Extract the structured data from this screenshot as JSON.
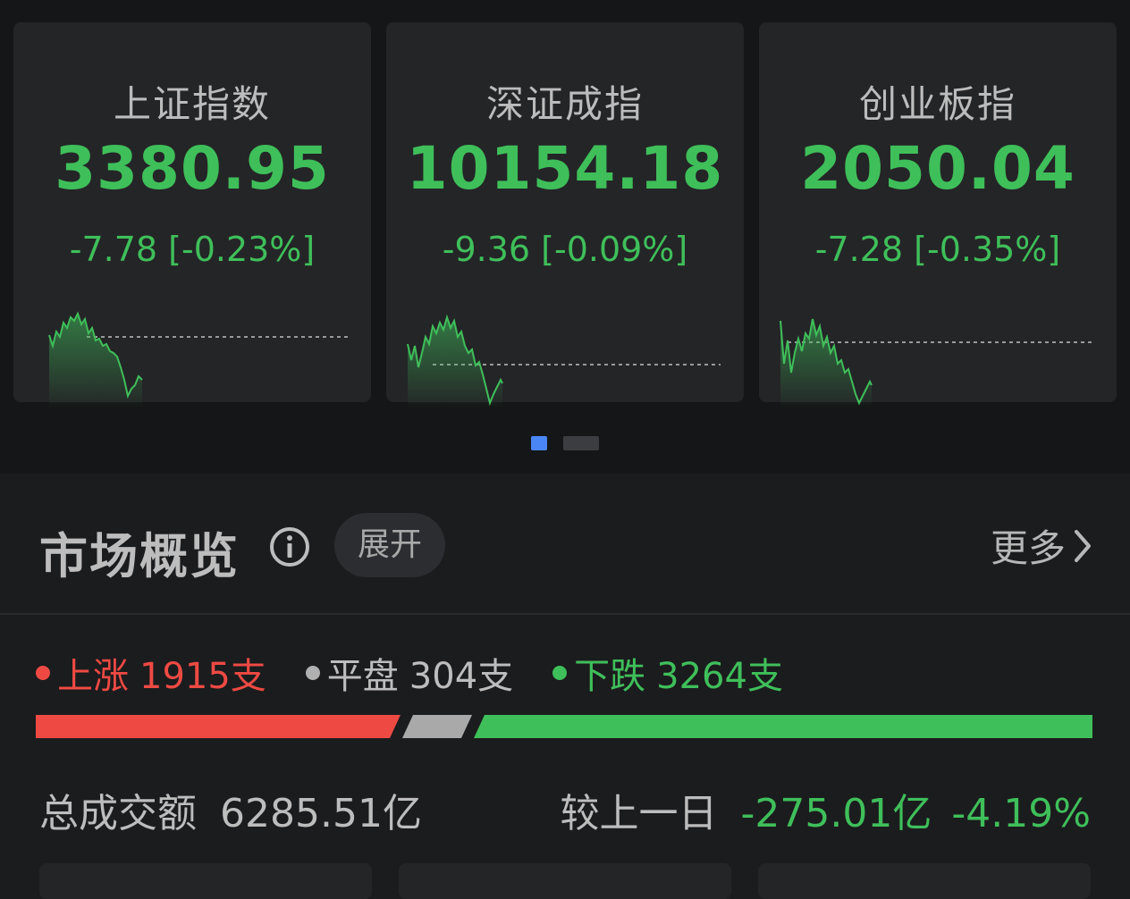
{
  "indices": [
    {
      "name": "上证指数",
      "value": "3380.95",
      "change": "-7.78 [-0.23%]"
    },
    {
      "name": "深证成指",
      "value": "10154.18",
      "change": "-9.36 [-0.09%]"
    },
    {
      "name": "创业板指",
      "value": "2050.04",
      "change": "-7.28 [-0.35%]"
    }
  ],
  "overview": {
    "title": "市场概览",
    "info_icon": "info-icon",
    "expand_label": "展开",
    "more_label": "更多",
    "up": {
      "label": "上涨",
      "count": "1915支"
    },
    "flat": {
      "label": "平盘",
      "count": "304支"
    },
    "down": {
      "label": "下跌",
      "count": "3264支"
    },
    "turnover_label": "总成交额",
    "turnover_value": "6285.51亿",
    "compare_label": "较上一日",
    "compare_value": "-275.01亿",
    "compare_percent": "-4.19%"
  },
  "colors": {
    "up": "#ee4a43",
    "flat": "#b0b0b0",
    "down": "#3fbf5a",
    "accent": "#4a86f5"
  }
}
